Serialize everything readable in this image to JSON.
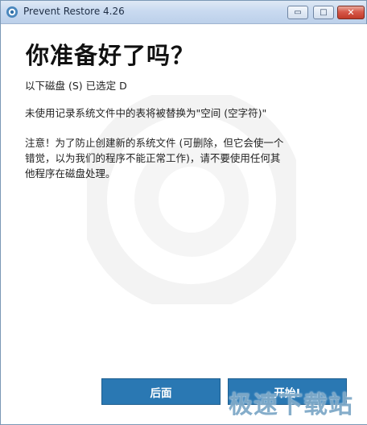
{
  "window": {
    "title": "Prevent Restore 4.26",
    "controls": {
      "minimize": "▭",
      "maximize": "□",
      "close": "✕"
    }
  },
  "main": {
    "heading": "你准备好了吗？",
    "drive_line": "以下磁盘 (S) 已选定 D",
    "replace_line": "未使用记录系统文件中的表将被替换为\"空间 (空字符)\"",
    "warning_lines": [
      "注意！为了防止创建新的系统文件 (可删除，但它会使一个",
      "错觉，以为我们的程序不能正常工作)，请不要使用任何其",
      "他程序在磁盘处理。"
    ]
  },
  "buttons": {
    "back": "后面",
    "start": "开始!"
  },
  "watermark_text": "极速下载站",
  "colors": {
    "accent": "#2a78b3",
    "titlebar": "#c9daf0",
    "close": "#c03a29"
  },
  "icons": {
    "app": "prevent-restore-icon",
    "background": "circle-watermark"
  }
}
